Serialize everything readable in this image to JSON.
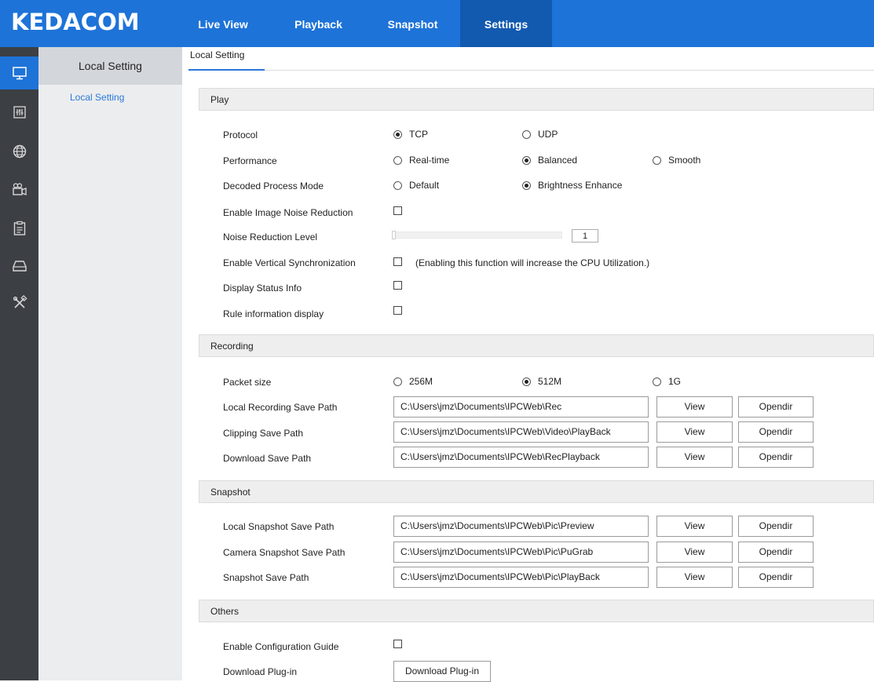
{
  "header": {
    "logo": "KEDACOM",
    "tabs": [
      {
        "label": "Live View",
        "active": false
      },
      {
        "label": "Playback",
        "active": false
      },
      {
        "label": "Snapshot",
        "active": false
      },
      {
        "label": "Settings",
        "active": true
      }
    ]
  },
  "sidebar_icons": [
    "monitor-icon",
    "equalizer-icon",
    "globe-icon",
    "camera-icon",
    "clipboard-icon",
    "storage-icon",
    "tools-icon"
  ],
  "submenu": {
    "title": "Local Setting",
    "items": [
      "Local Setting"
    ]
  },
  "content": {
    "subtab": "Local Setting",
    "play": {
      "title": "Play",
      "protocol": {
        "label": "Protocol",
        "options": [
          "TCP",
          "UDP"
        ],
        "selected": "TCP"
      },
      "performance": {
        "label": "Performance",
        "options": [
          "Real-time",
          "Balanced",
          "Smooth"
        ],
        "selected": "Balanced"
      },
      "decode": {
        "label": "Decoded Process Mode",
        "options": [
          "Default",
          "Brightness Enhance"
        ],
        "selected": "Brightness Enhance"
      },
      "noise_enable": {
        "label": "Enable Image Noise Reduction",
        "checked": false
      },
      "noise_level": {
        "label": "Noise Reduction Level",
        "value": "1"
      },
      "vsync": {
        "label": "Enable Vertical Synchronization",
        "checked": false,
        "note": "(Enabling this function will increase the CPU Utilization.)"
      },
      "status_info": {
        "label": "Display Status Info",
        "checked": false
      },
      "rule_info": {
        "label": "Rule information display",
        "checked": false
      }
    },
    "recording": {
      "title": "Recording",
      "packet": {
        "label": "Packet size",
        "options": [
          "256M",
          "512M",
          "1G"
        ],
        "selected": "512M"
      },
      "paths": [
        {
          "label": "Local Recording Save Path",
          "value": "C:\\Users\\jmz\\Documents\\IPCWeb\\Rec"
        },
        {
          "label": "Clipping Save Path",
          "value": "C:\\Users\\jmz\\Documents\\IPCWeb\\Video\\PlayBack"
        },
        {
          "label": "Download Save Path",
          "value": "C:\\Users\\jmz\\Documents\\IPCWeb\\RecPlayback"
        }
      ]
    },
    "snapshot": {
      "title": "Snapshot",
      "paths": [
        {
          "label": "Local Snapshot Save Path",
          "value": "C:\\Users\\jmz\\Documents\\IPCWeb\\Pic\\Preview"
        },
        {
          "label": "Camera Snapshot Save Path",
          "value": "C:\\Users\\jmz\\Documents\\IPCWeb\\Pic\\PuGrab"
        },
        {
          "label": "Snapshot Save Path",
          "value": "C:\\Users\\jmz\\Documents\\IPCWeb\\Pic\\PlayBack"
        }
      ]
    },
    "others": {
      "title": "Others",
      "guide": {
        "label": "Enable Configuration Guide",
        "checked": false
      },
      "plugin": {
        "label": "Download Plug-in",
        "button": "Download Plug-in"
      }
    },
    "buttons": {
      "view": "View",
      "opendir": "Opendir"
    }
  }
}
